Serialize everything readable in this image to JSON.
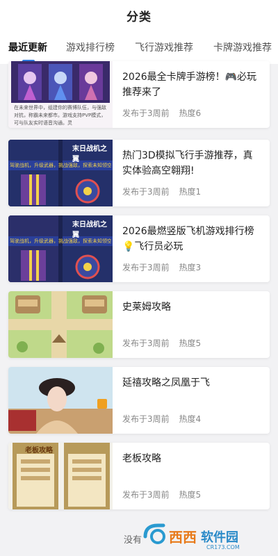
{
  "header": {
    "title": "分类"
  },
  "tabs": [
    {
      "label": "最近更新",
      "active": true
    },
    {
      "label": "游戏排行榜",
      "active": false
    },
    {
      "label": "飞行游戏推荐",
      "active": false
    },
    {
      "label": "卡牌游戏推荐",
      "active": false
    }
  ],
  "articles": [
    {
      "title": "2026最全卡牌手游榜！🎮必玩推荐来了",
      "published": "发布于3周前",
      "heat": "热度6",
      "thumb_icon": "card-game-thumbnail"
    },
    {
      "title": "热门3D模拟飞行手游推荐，真实体验高空翱翔!",
      "published": "发布于3周前",
      "heat": "热度1",
      "thumb_icon": "flight-game-thumbnail"
    },
    {
      "title": "2026最燃竖版飞机游戏排行榜💡飞行员必玩",
      "published": "发布于3周前",
      "heat": "热度3",
      "thumb_icon": "plane-shooter-thumbnail"
    },
    {
      "title": "史莱姆攻略",
      "published": "发布于3周前",
      "heat": "热度5",
      "thumb_icon": "slime-game-thumbnail"
    },
    {
      "title": "延禧攻略之凤凰于飞",
      "published": "发布于3周前",
      "heat": "热度4",
      "thumb_icon": "palace-drama-thumbnail"
    },
    {
      "title": "老板攻略",
      "published": "发布于3周前",
      "heat": "热度5",
      "thumb_icon": "boss-game-thumbnail"
    }
  ],
  "thumb_texts": {
    "card_desc": "在未来世界中，组建你的赛博队伍，与强敌对抗，称霸未来都市。游戏支持PVP模式，可与队友实时语音沟通。灵",
    "flight_title": "末日战机之翼",
    "flight_sub": "驾驶战机，升级武器，挑战强敌，探索未知领空。",
    "boss_title": "老板攻略"
  },
  "footer": {
    "text": "没有"
  },
  "watermark": {
    "brand": "西西",
    "sub": "软件园",
    "url": "CR173.COM"
  },
  "colors": {
    "accent": "#2f7de1",
    "background": "#f2f2f4"
  }
}
